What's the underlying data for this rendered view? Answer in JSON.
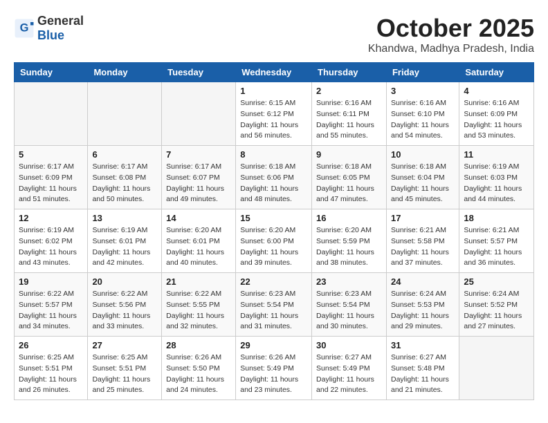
{
  "header": {
    "logo_general": "General",
    "logo_blue": "Blue",
    "month": "October 2025",
    "location": "Khandwa, Madhya Pradesh, India"
  },
  "weekdays": [
    "Sunday",
    "Monday",
    "Tuesday",
    "Wednesday",
    "Thursday",
    "Friday",
    "Saturday"
  ],
  "weeks": [
    [
      {
        "day": "",
        "info": ""
      },
      {
        "day": "",
        "info": ""
      },
      {
        "day": "",
        "info": ""
      },
      {
        "day": "1",
        "info": "Sunrise: 6:15 AM\nSunset: 6:12 PM\nDaylight: 11 hours\nand 56 minutes."
      },
      {
        "day": "2",
        "info": "Sunrise: 6:16 AM\nSunset: 6:11 PM\nDaylight: 11 hours\nand 55 minutes."
      },
      {
        "day": "3",
        "info": "Sunrise: 6:16 AM\nSunset: 6:10 PM\nDaylight: 11 hours\nand 54 minutes."
      },
      {
        "day": "4",
        "info": "Sunrise: 6:16 AM\nSunset: 6:09 PM\nDaylight: 11 hours\nand 53 minutes."
      }
    ],
    [
      {
        "day": "5",
        "info": "Sunrise: 6:17 AM\nSunset: 6:09 PM\nDaylight: 11 hours\nand 51 minutes."
      },
      {
        "day": "6",
        "info": "Sunrise: 6:17 AM\nSunset: 6:08 PM\nDaylight: 11 hours\nand 50 minutes."
      },
      {
        "day": "7",
        "info": "Sunrise: 6:17 AM\nSunset: 6:07 PM\nDaylight: 11 hours\nand 49 minutes."
      },
      {
        "day": "8",
        "info": "Sunrise: 6:18 AM\nSunset: 6:06 PM\nDaylight: 11 hours\nand 48 minutes."
      },
      {
        "day": "9",
        "info": "Sunrise: 6:18 AM\nSunset: 6:05 PM\nDaylight: 11 hours\nand 47 minutes."
      },
      {
        "day": "10",
        "info": "Sunrise: 6:18 AM\nSunset: 6:04 PM\nDaylight: 11 hours\nand 45 minutes."
      },
      {
        "day": "11",
        "info": "Sunrise: 6:19 AM\nSunset: 6:03 PM\nDaylight: 11 hours\nand 44 minutes."
      }
    ],
    [
      {
        "day": "12",
        "info": "Sunrise: 6:19 AM\nSunset: 6:02 PM\nDaylight: 11 hours\nand 43 minutes."
      },
      {
        "day": "13",
        "info": "Sunrise: 6:19 AM\nSunset: 6:01 PM\nDaylight: 11 hours\nand 42 minutes."
      },
      {
        "day": "14",
        "info": "Sunrise: 6:20 AM\nSunset: 6:01 PM\nDaylight: 11 hours\nand 40 minutes."
      },
      {
        "day": "15",
        "info": "Sunrise: 6:20 AM\nSunset: 6:00 PM\nDaylight: 11 hours\nand 39 minutes."
      },
      {
        "day": "16",
        "info": "Sunrise: 6:20 AM\nSunset: 5:59 PM\nDaylight: 11 hours\nand 38 minutes."
      },
      {
        "day": "17",
        "info": "Sunrise: 6:21 AM\nSunset: 5:58 PM\nDaylight: 11 hours\nand 37 minutes."
      },
      {
        "day": "18",
        "info": "Sunrise: 6:21 AM\nSunset: 5:57 PM\nDaylight: 11 hours\nand 36 minutes."
      }
    ],
    [
      {
        "day": "19",
        "info": "Sunrise: 6:22 AM\nSunset: 5:57 PM\nDaylight: 11 hours\nand 34 minutes."
      },
      {
        "day": "20",
        "info": "Sunrise: 6:22 AM\nSunset: 5:56 PM\nDaylight: 11 hours\nand 33 minutes."
      },
      {
        "day": "21",
        "info": "Sunrise: 6:22 AM\nSunset: 5:55 PM\nDaylight: 11 hours\nand 32 minutes."
      },
      {
        "day": "22",
        "info": "Sunrise: 6:23 AM\nSunset: 5:54 PM\nDaylight: 11 hours\nand 31 minutes."
      },
      {
        "day": "23",
        "info": "Sunrise: 6:23 AM\nSunset: 5:54 PM\nDaylight: 11 hours\nand 30 minutes."
      },
      {
        "day": "24",
        "info": "Sunrise: 6:24 AM\nSunset: 5:53 PM\nDaylight: 11 hours\nand 29 minutes."
      },
      {
        "day": "25",
        "info": "Sunrise: 6:24 AM\nSunset: 5:52 PM\nDaylight: 11 hours\nand 27 minutes."
      }
    ],
    [
      {
        "day": "26",
        "info": "Sunrise: 6:25 AM\nSunset: 5:51 PM\nDaylight: 11 hours\nand 26 minutes."
      },
      {
        "day": "27",
        "info": "Sunrise: 6:25 AM\nSunset: 5:51 PM\nDaylight: 11 hours\nand 25 minutes."
      },
      {
        "day": "28",
        "info": "Sunrise: 6:26 AM\nSunset: 5:50 PM\nDaylight: 11 hours\nand 24 minutes."
      },
      {
        "day": "29",
        "info": "Sunrise: 6:26 AM\nSunset: 5:49 PM\nDaylight: 11 hours\nand 23 minutes."
      },
      {
        "day": "30",
        "info": "Sunrise: 6:27 AM\nSunset: 5:49 PM\nDaylight: 11 hours\nand 22 minutes."
      },
      {
        "day": "31",
        "info": "Sunrise: 6:27 AM\nSunset: 5:48 PM\nDaylight: 11 hours\nand 21 minutes."
      },
      {
        "day": "",
        "info": ""
      }
    ]
  ]
}
